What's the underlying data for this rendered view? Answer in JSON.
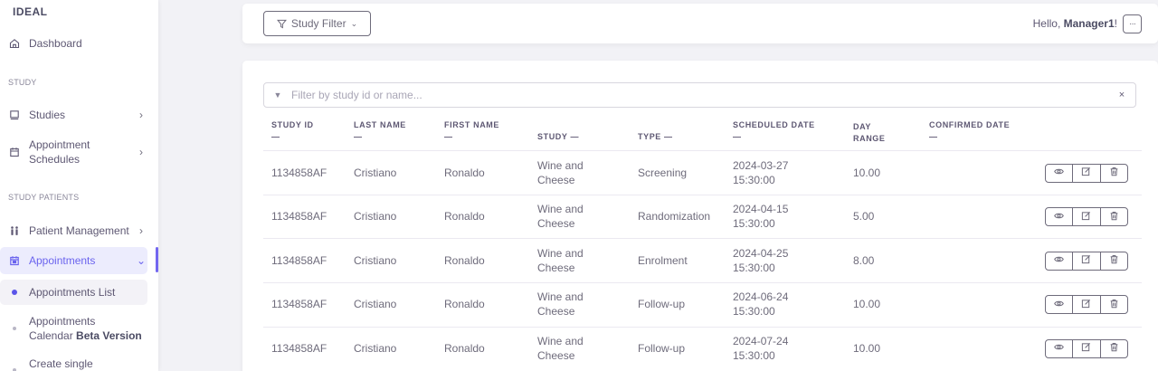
{
  "sidebar": {
    "brand": "IDEAL",
    "dashboard": "Dashboard",
    "section_study": "STUDY",
    "studies": "Studies",
    "appointment_schedules_1": "Appointment",
    "appointment_schedules_2": "Schedules",
    "section_patients": "STUDY PATIENTS",
    "patient_management": "Patient Management",
    "appointments": "Appointments",
    "appointments_list": "Appointments List",
    "calendar_1": "Appointments",
    "calendar_2": "Calendar",
    "calendar_beta": "Beta Version",
    "create_single": "Create single"
  },
  "header": {
    "study_filter": "Study Filter",
    "hello": "Hello, ",
    "user": "Manager1",
    "exclaim": "!",
    "more": "···"
  },
  "search": {
    "placeholder": "Filter by study id or name...",
    "clear": "×"
  },
  "table": {
    "headers": {
      "study_id": "STUDY ID",
      "last_name": "LAST NAME",
      "first_name": "FIRST NAME",
      "study": "STUDY",
      "type": "TYPE",
      "scheduled_1": "SCHEDULED DATE",
      "day_1": "DAY",
      "day_2": "RANGE",
      "confirmed": "CONFIRMED DATE",
      "sort": "—"
    },
    "rows": [
      {
        "study_id": "1134858AF",
        "last_name": "Cristiano",
        "first_name": "Ronaldo",
        "study_1": "Wine and",
        "study_2": "Cheese",
        "type": "Screening",
        "date": "2024-03-27",
        "time": "15:30:00",
        "range": "10.00",
        "confirmed": ""
      },
      {
        "study_id": "1134858AF",
        "last_name": "Cristiano",
        "first_name": "Ronaldo",
        "study_1": "Wine and",
        "study_2": "Cheese",
        "type": "Randomization",
        "date": "2024-04-15",
        "time": "15:30:00",
        "range": "5.00",
        "confirmed": ""
      },
      {
        "study_id": "1134858AF",
        "last_name": "Cristiano",
        "first_name": "Ronaldo",
        "study_1": "Wine and",
        "study_2": "Cheese",
        "type": "Enrolment",
        "date": "2024-04-25",
        "time": "15:30:00",
        "range": "8.00",
        "confirmed": ""
      },
      {
        "study_id": "1134858AF",
        "last_name": "Cristiano",
        "first_name": "Ronaldo",
        "study_1": "Wine and",
        "study_2": "Cheese",
        "type": "Follow-up",
        "date": "2024-06-24",
        "time": "15:30:00",
        "range": "10.00",
        "confirmed": ""
      },
      {
        "study_id": "1134858AF",
        "last_name": "Cristiano",
        "first_name": "Ronaldo",
        "study_1": "Wine and",
        "study_2": "Cheese",
        "type": "Follow-up",
        "date": "2024-07-24",
        "time": "15:30:00",
        "range": "10.00",
        "confirmed": ""
      }
    ],
    "action_icons": [
      "eye-icon",
      "edit-icon",
      "trash-icon"
    ]
  },
  "colors": {
    "accent": "#7367f0",
    "text": "#6e6b7b"
  }
}
